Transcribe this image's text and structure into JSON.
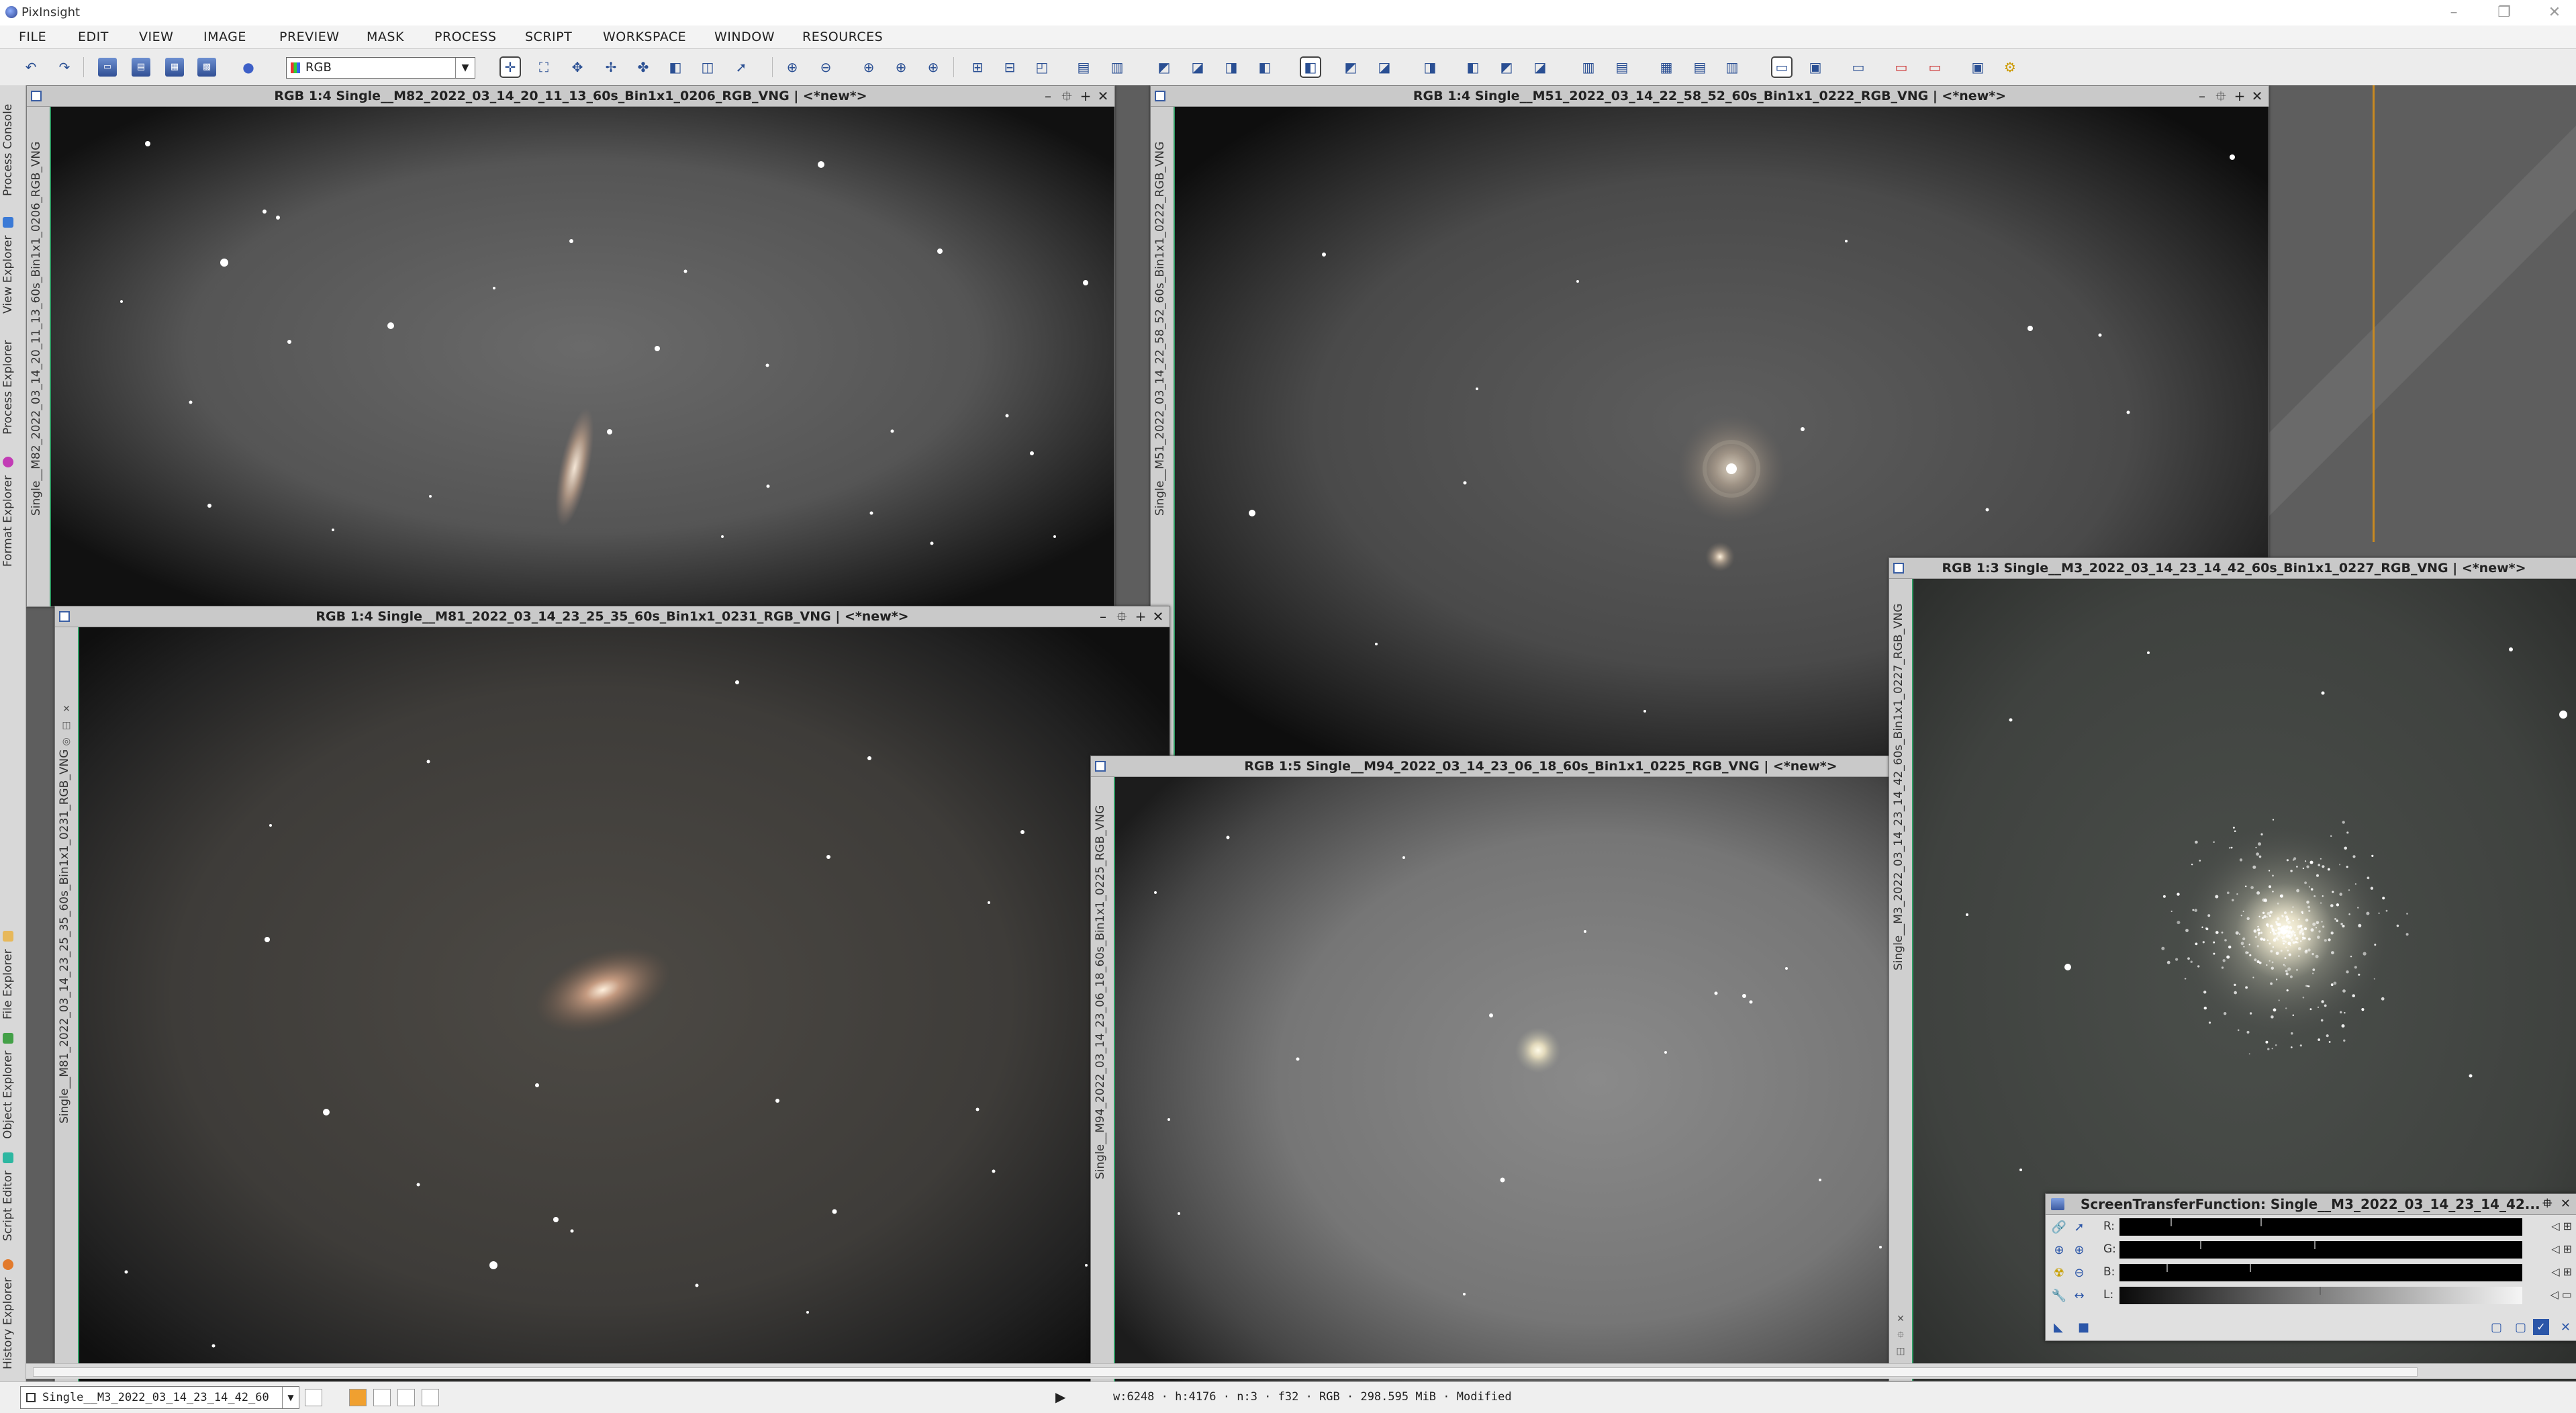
{
  "app": {
    "title": "PixInsight"
  },
  "menu": [
    "FILE",
    "EDIT",
    "VIEW",
    "IMAGE",
    "PREVIEW",
    "MASK",
    "PROCESS",
    "SCRIPT",
    "WORKSPACE",
    "WINDOW",
    "RESOURCES"
  ],
  "toolbar": {
    "rgb_select": "RGB"
  },
  "left_explorers": [
    "Process Console",
    "View Explorer",
    "Process Explorer",
    "Format Explorer",
    "File Explorer",
    "Object Explorer",
    "Script Editor",
    "History Explorer"
  ],
  "windows": [
    {
      "title": "RGB 1:4 Single__M82_2022_03_14_20_11_13_60s_Bin1x1_0206_RGB_VNG | <*new*>",
      "side_label": "Single__M82_2022_03_14_20_11_13_60s_Bin1x1_0206_RGB_VNG"
    },
    {
      "title": "RGB 1:4 Single__M51_2022_03_14_22_58_52_60s_Bin1x1_0222_RGB_VNG | <*new*>",
      "side_label": "Single__M51_2022_03_14_22_58_52_60s_Bin1x1_0222_RGB_VNG"
    },
    {
      "title": "RGB 1:4 Single__M81_2022_03_14_23_25_35_60s_Bin1x1_0231_RGB_VNG | <*new*>",
      "side_label": "Single__M81_2022_03_14_23_25_35_60s_Bin1x1_0231_RGB_VNG"
    },
    {
      "title": "RGB 1:5 Single__M94_2022_03_14_23_06_18_60s_Bin1x1_0225_RGB_VNG | <*new*>",
      "side_label": "Single__M94_2022_03_14_23_06_18_60s_Bin1x1_0225_RGB_VNG"
    },
    {
      "title": "RGB 1:3 Single__M3_2022_03_14_23_14_42_60s_Bin1x1_0227_RGB_VNG | <*new*>",
      "side_label": "Single__M3_2022_03_14_23_14_42_60s_Bin1x1_0227_RGB_VNG"
    }
  ],
  "stf": {
    "title": "ScreenTransferFunction: Single__M3_2022_03_14_23_14_42...",
    "channels": [
      "R:",
      "G:",
      "B:",
      "L:"
    ]
  },
  "statusbar": {
    "view_select": "Single__M3_2022_03_14_23_14_42_60",
    "info": "w:6248 · h:4176 · n:3 · f32 · RGB · 298.595 MiB · Modified"
  },
  "colors": {
    "accent_green": "#2e9a62",
    "toolbar_blue": "#2a4f93"
  }
}
